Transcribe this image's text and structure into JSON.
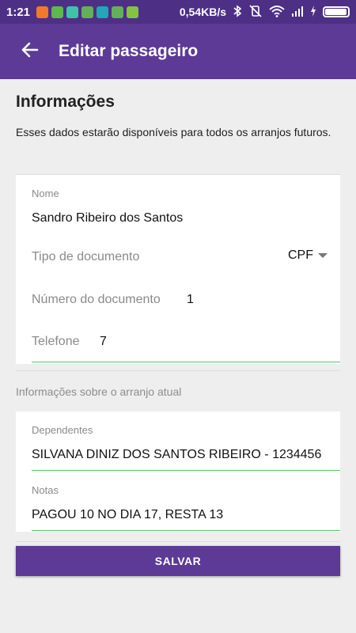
{
  "status_bar": {
    "time": "1:21",
    "speed": "0,54KB/s",
    "notification_icons": [
      {
        "name": "orange-app-icon",
        "color": "#f07a2a"
      },
      {
        "name": "green-app-icon",
        "color": "#5fb84e"
      },
      {
        "name": "play-store-icon",
        "color": "#3ec3a6"
      },
      {
        "name": "maps-icon",
        "color": "#64b05a"
      },
      {
        "name": "teal-app-icon",
        "color": "#22a7b5"
      },
      {
        "name": "maps-icon-2",
        "color": "#64b05a"
      },
      {
        "name": "android-app-icon",
        "color": "#82c341"
      }
    ],
    "battery_level": 0.95
  },
  "app_bar": {
    "title": "Editar passageiro"
  },
  "info_section": {
    "title": "Informações",
    "description": "Esses dados estarão disponíveis para todos os arranjos futuros."
  },
  "form": {
    "name_label": "Nome",
    "name_value": "Sandro Ribeiro dos Santos",
    "doc_type_label": "Tipo de documento",
    "doc_type_value": "CPF",
    "doc_number_label": "Número do documento",
    "doc_number_value": "1",
    "phone_label": "Telefone",
    "phone_value": "7"
  },
  "arrangement_section": {
    "title": "Informações sobre o arranjo atual",
    "dependents_label": "Dependentes",
    "dependents_value": "SILVANA DINIZ DOS SANTOS RIBEIRO - 1234456",
    "notes_label": "Notas",
    "notes_value": "PAGOU 10 NO DIA 17, RESTA 13"
  },
  "actions": {
    "save_label": "SALVAR"
  },
  "colors": {
    "primary": "#5c3a96",
    "status_bar": "#4e2f86",
    "accent_underline": "#58c46a"
  }
}
